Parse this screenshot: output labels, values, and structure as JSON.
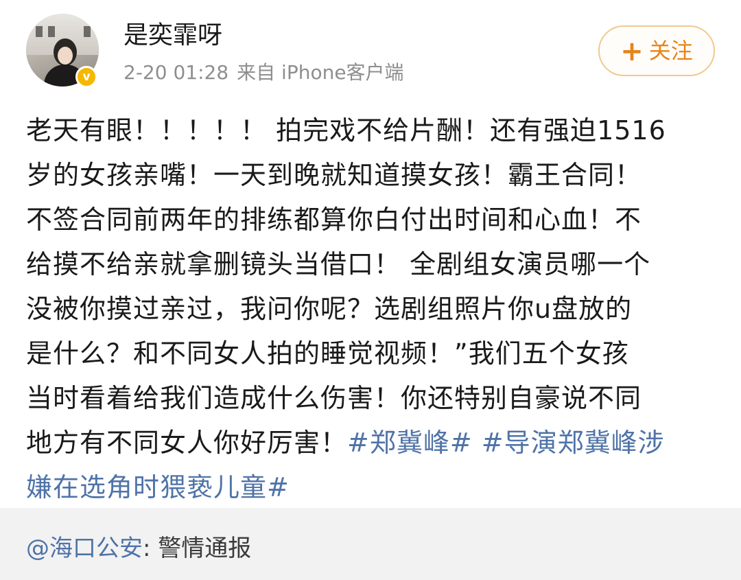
{
  "post": {
    "username": "是奕霏呀",
    "timestamp": "2-20 01:28",
    "source": "来自 iPhone客户端",
    "follow_label": "关注",
    "follow_icon": "plus-icon",
    "verified_icon": "verified-badge-icon",
    "verified_glyph": "v",
    "content_lines": [
      "老天有眼！！！！！ 拍完戏不给片酬！还有强迫1516",
      "岁的女孩亲嘴！一天到晚就知道摸女孩！霸王合同！",
      "不签合同前两年的排练都算你白付出时间和心血！不",
      "给摸不给亲就拿删镜头当借口！ 全剧组女演员哪一个",
      "没被你摸过亲过，我问你呢？选剧组照片你u盘放的",
      "是什么？和不同女人拍的睡觉视频！”我们五个女孩",
      "当时看着给我们造成什么伤害！你还特别自豪说不同"
    ],
    "content_line_8_text": "地方有不同女人你好厉害！",
    "hashtag_1": "#郑冀峰#",
    "hashtag_2_part1": "#导演郑冀峰涉",
    "hashtag_2_part2": "嫌在选角时猥亵儿童#"
  },
  "repost": {
    "mention": "@海口公安",
    "separator": ":",
    "text": "警情通报"
  },
  "colors": {
    "link": "#4f73a8",
    "follow_accent": "#e8831c",
    "follow_border": "#f0c98e",
    "meta_gray": "#8e8e8e",
    "band_gray": "#f2f2f2",
    "verified_gold": "#f5b800"
  }
}
